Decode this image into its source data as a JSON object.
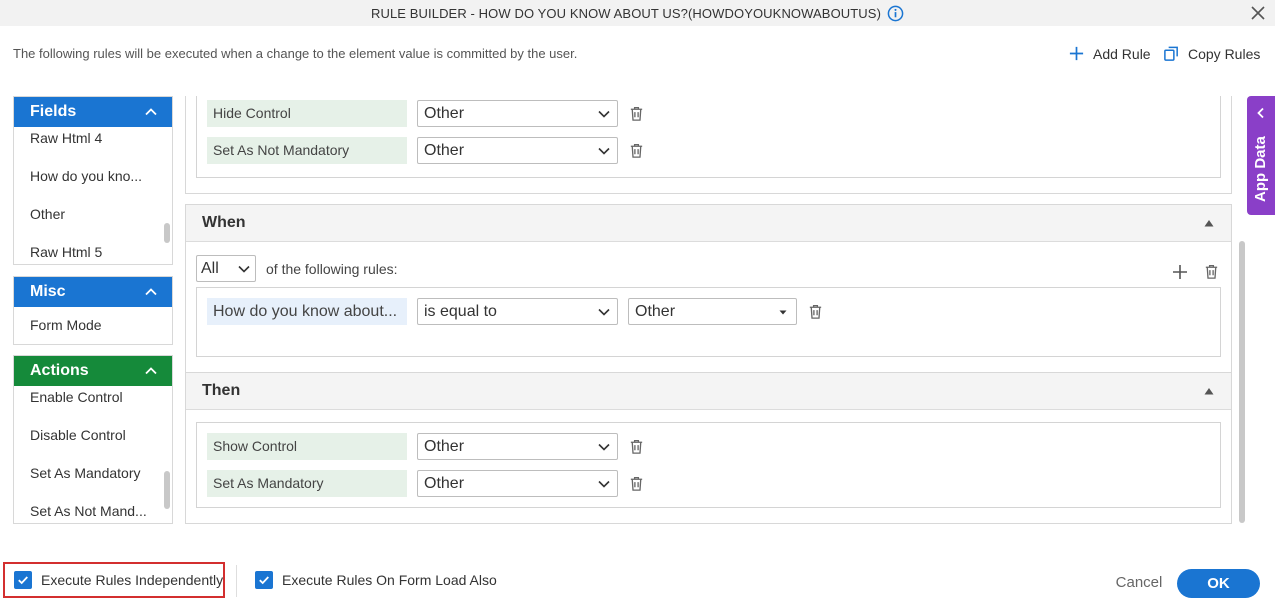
{
  "dialog": {
    "title": "RULE BUILDER - HOW DO YOU KNOW ABOUT US?(HOWDOYOUKNOWABOUTUS)",
    "subtitle": "The following rules will be executed when a change to the element value is committed by the user.",
    "add_rule_label": "Add Rule",
    "copy_rules_label": "Copy Rules"
  },
  "sidebar": {
    "fields": {
      "title": "Fields",
      "items": [
        "Raw Html 4",
        "How do you kno...",
        "Other",
        "Raw Html 5"
      ]
    },
    "misc": {
      "title": "Misc",
      "items": [
        "Form Mode"
      ]
    },
    "actions": {
      "title": "Actions",
      "items": [
        "Enable Control",
        "Disable Control",
        "Set As Mandatory",
        "Set As Not Mand..."
      ]
    }
  },
  "top_actions": [
    {
      "action": "Hide Control",
      "target": "Other"
    },
    {
      "action": "Set As Not Mandatory",
      "target": "Other"
    }
  ],
  "when": {
    "title": "When",
    "match": "All",
    "match_suffix": "of the following rules:",
    "condition": {
      "field": "How do you know about...",
      "operator": "is equal to",
      "value": "Other"
    }
  },
  "then": {
    "title": "Then",
    "actions": [
      {
        "action": "Show Control",
        "target": "Other"
      },
      {
        "action": "Set As Mandatory",
        "target": "Other"
      }
    ]
  },
  "app_data_label": "App Data",
  "footer": {
    "execute_independently": "Execute Rules Independently",
    "execute_on_load": "Execute Rules On Form Load Also",
    "cancel": "Cancel",
    "ok": "OK"
  },
  "colors": {
    "accent": "#1a75d2",
    "actions_header": "#158a3a",
    "app_data": "#8a3fc8",
    "highlight": "#d32f2f"
  }
}
